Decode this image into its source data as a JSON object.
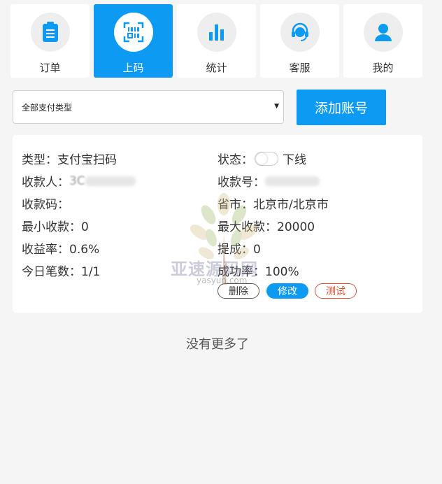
{
  "nav": [
    {
      "label": "订单",
      "icon": "clipboard-icon",
      "active": false
    },
    {
      "label": "上码",
      "icon": "barcode-icon",
      "active": true
    },
    {
      "label": "统计",
      "icon": "bar-chart-icon",
      "active": false
    },
    {
      "label": "客服",
      "icon": "headset-icon",
      "active": false
    },
    {
      "label": "我的",
      "icon": "user-icon",
      "active": false
    }
  ],
  "filter": {
    "selected": "全部支付类型"
  },
  "add_button": "添加账号",
  "account": {
    "type": "类型：支付宝扫码",
    "status_label": "状态：",
    "status_value": "下线",
    "payee_label": "收款人：",
    "payee_value_visible": "3C",
    "account_no_label": "收款号：",
    "qr_label": "收款码：",
    "region": "省市：北京市/北京市",
    "min_amount": "最小收款：0",
    "max_amount": "最大收款：20000",
    "yield_rate": "收益率：0.6%",
    "commission": "提成：0",
    "today_count": "今日笔数：1/1",
    "success_rate": "成功率：100%",
    "delete_label": "删除",
    "edit_label": "修改",
    "test_label": "测试"
  },
  "watermark": {
    "title": "亚速源码网",
    "subtitle": "yasyun.com"
  },
  "footer_text": "没有更多了",
  "colors": {
    "accent": "#0d9af2",
    "danger": "#e0502b",
    "background": "#f5f5f5"
  }
}
